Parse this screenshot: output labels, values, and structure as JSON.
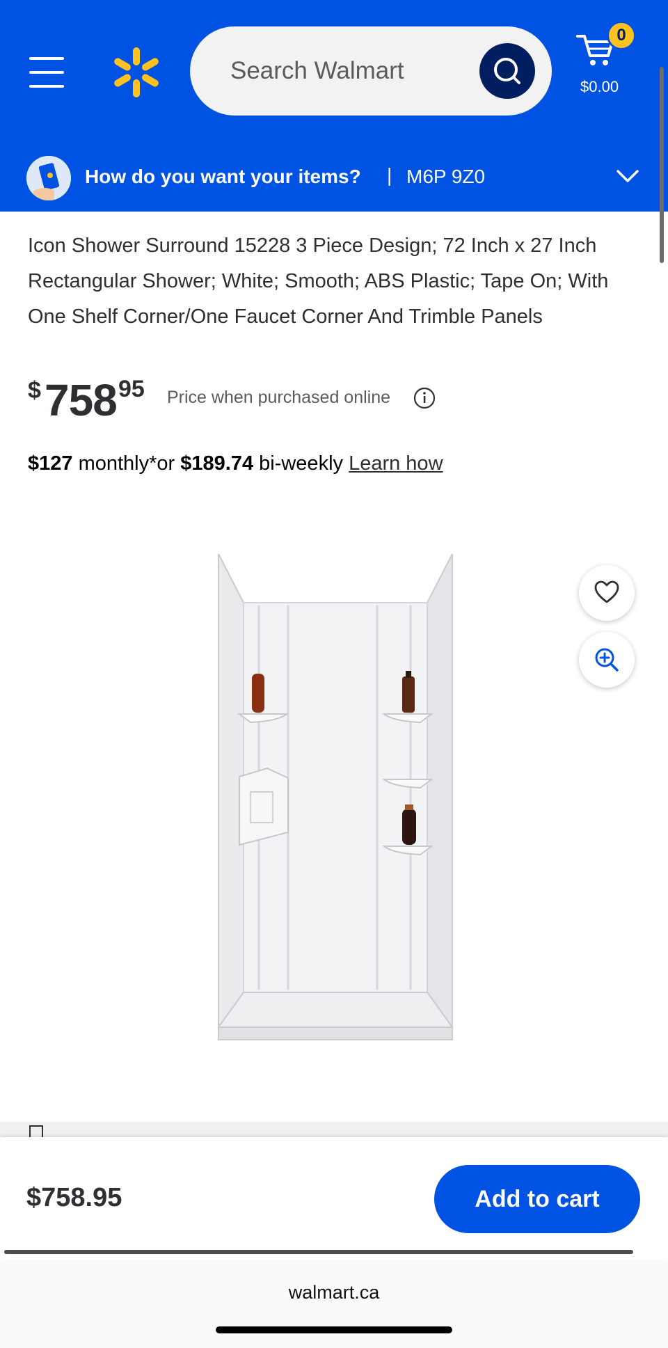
{
  "header": {
    "search_placeholder": "Search Walmart",
    "cart_count": "0",
    "cart_total": "$0.00"
  },
  "fulfillment": {
    "question": "How do you want your items?",
    "separator": "|",
    "postal_code": "M6P 9Z0"
  },
  "product": {
    "title": "Icon Shower Surround 15228 3 Piece Design; 72 Inch x 27 Inch Rectangular Shower; White; Smooth; ABS Plastic; Tape On; With One Shelf Corner/One Faucet Corner And Trimble Panels",
    "price_currency": "$",
    "price_whole": "758",
    "price_cents": "95",
    "price_note": "Price when purchased online",
    "monthly_amount": "$127",
    "monthly_text": " monthly*or ",
    "biweekly_amount": "$189.74",
    "biweekly_text": " bi-weekly ",
    "learn_how": "Learn how"
  },
  "bottom_bar": {
    "price": "$758.95",
    "add_to_cart": "Add to cart"
  },
  "browser": {
    "url": "walmart.ca"
  },
  "colors": {
    "brand_blue": "#0053e2",
    "spark_yellow": "#ffc220",
    "dark_blue": "#001e60"
  }
}
